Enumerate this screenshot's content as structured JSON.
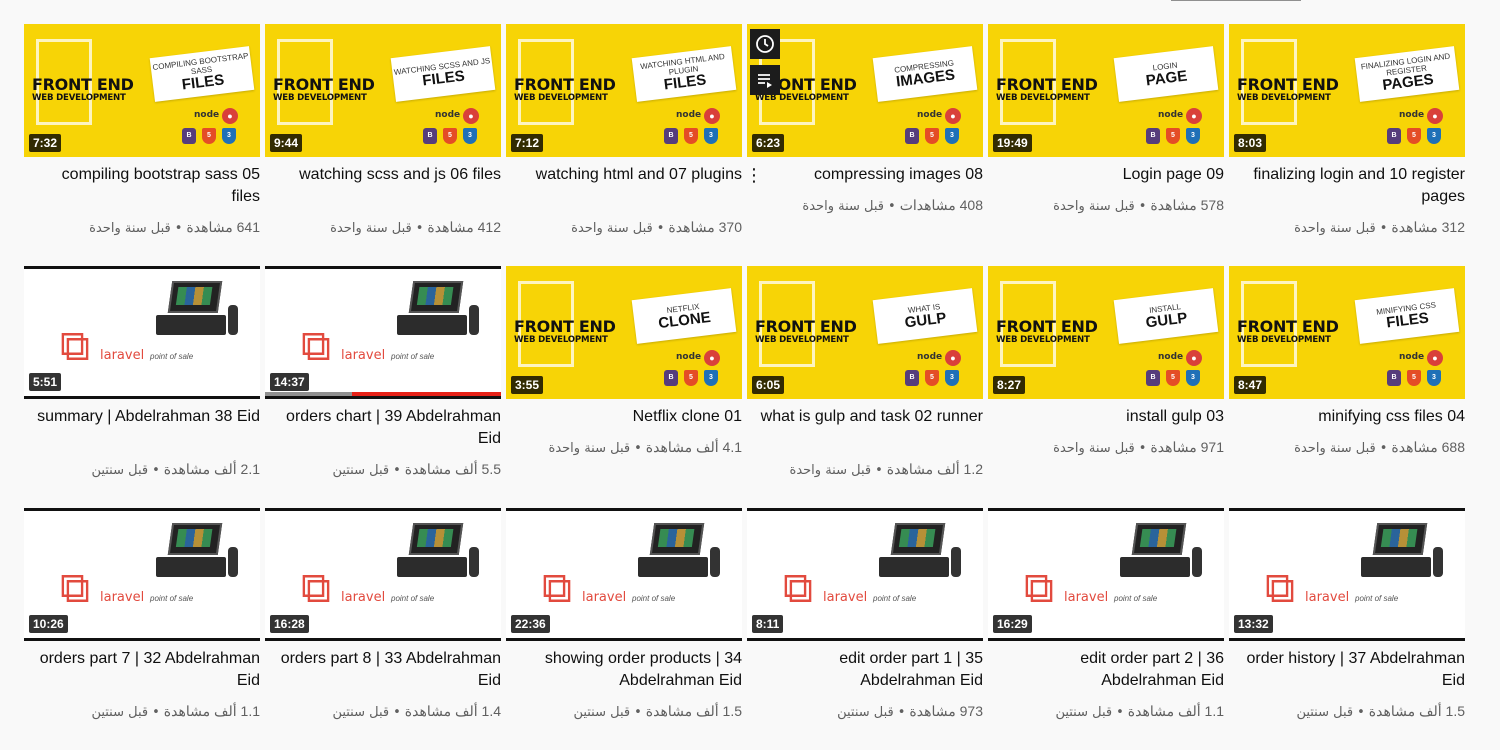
{
  "videos": [
    {
      "kind": "fe",
      "tag_small": "COMPILING BOOTSTRAP SASS",
      "tag_big": "FILES",
      "duration": "7:32",
      "title": "compiling bootstrap sass 05 files",
      "views": "641 مشاهدة",
      "age": "قبل سنة واحدة"
    },
    {
      "kind": "fe",
      "tag_small": "WATCHING SCSS AND JS",
      "tag_big": "FILES",
      "duration": "9:44",
      "title": "watching scss and js 06 files",
      "views": "412 مشاهدة",
      "age": "قبل سنة واحدة"
    },
    {
      "kind": "fe",
      "tag_small": "WATCHING HTML AND PLUGIN",
      "tag_big": "FILES",
      "duration": "7:12",
      "title": "watching html and 07 plugins",
      "views": "370 مشاهدة",
      "age": "قبل سنة واحدة"
    },
    {
      "kind": "fe",
      "tag_small": "COMPRESSING",
      "tag_big": "IMAGES",
      "duration": "6:23",
      "title": "compressing images 08",
      "views": "408 مشاهدات",
      "age": "قبل سنة واحدة",
      "hovered": true
    },
    {
      "kind": "fe",
      "tag_small": "LOGIN",
      "tag_big": "PAGE",
      "duration": "19:49",
      "title": "Login page 09",
      "views": "578 مشاهدة",
      "age": "قبل سنة واحدة"
    },
    {
      "kind": "fe",
      "tag_small": "FINALIZING LOGIN AND REGISTER",
      "tag_big": "PAGES",
      "duration": "8:03",
      "title": "finalizing login and 10 register pages",
      "views": "312 مشاهدة",
      "age": "قبل سنة واحدة"
    },
    {
      "kind": "laravel",
      "duration": "5:51",
      "title": "summary | Abdelrahman 38 Eid",
      "views": "2.1 ألف مشاهدة",
      "age": "قبل سنتين"
    },
    {
      "kind": "laravel",
      "duration": "14:37",
      "title": "orders chart | 39 Abdelrahman Eid",
      "views": "5.5 ألف مشاهدة",
      "age": "قبل سنتين",
      "progress": 0.63
    },
    {
      "kind": "fe",
      "tag_small": "NETFLIX",
      "tag_big": "CLONE",
      "duration": "3:55",
      "title": "Netflix clone 01",
      "views": "4.1 ألف مشاهدة",
      "age": "قبل سنة واحدة"
    },
    {
      "kind": "fe",
      "tag_small": "WHAT IS",
      "tag_big": "GULP",
      "duration": "6:05",
      "title": "what is gulp and task 02 runner",
      "views": "1.2 ألف مشاهدة",
      "age": "قبل سنة واحدة"
    },
    {
      "kind": "fe",
      "tag_small": "INSTALL",
      "tag_big": "GULP",
      "duration": "8:27",
      "title": "install gulp 03",
      "views": "971 مشاهدة",
      "age": "قبل سنة واحدة"
    },
    {
      "kind": "fe",
      "tag_small": "MINIFYING CSS",
      "tag_big": "FILES",
      "duration": "8:47",
      "title": "minifying css files 04",
      "views": "688 مشاهدة",
      "age": "قبل سنة واحدة"
    },
    {
      "kind": "laravel",
      "duration": "10:26",
      "title": "orders part 7 | 32 Abdelrahman Eid",
      "views": "1.1 ألف مشاهدة",
      "age": "قبل سنتين"
    },
    {
      "kind": "laravel",
      "duration": "16:28",
      "title": "orders part 8 | 33 Abdelrahman Eid",
      "views": "1.4 ألف مشاهدة",
      "age": "قبل سنتين"
    },
    {
      "kind": "laravel",
      "duration": "22:36",
      "title": "showing order products | 34 Abdelrahman Eid",
      "views": "1.5 ألف مشاهدة",
      "age": "قبل سنتين"
    },
    {
      "kind": "laravel",
      "duration": "8:11",
      "title": "edit order part 1 | 35 Abdelrahman Eid",
      "views": "973 مشاهدة",
      "age": "قبل سنتين"
    },
    {
      "kind": "laravel",
      "duration": "16:29",
      "title": "edit order part 2 | 36 Abdelrahman Eid",
      "views": "1.1 ألف مشاهدة",
      "age": "قبل سنتين"
    },
    {
      "kind": "laravel",
      "duration": "13:32",
      "title": "order history | 37 Abdelrahman Eid",
      "views": "1.5 ألف مشاهدة",
      "age": "قبل سنتين"
    }
  ],
  "thumb_text": {
    "fe_title": "FRONT END",
    "fe_subtitle": "WEB DEVELOPMENT",
    "node": "node",
    "laravel_word": "laravel",
    "laravel_tagline": "point of sale",
    "badge_html": "HTML",
    "badge_css": "CSS",
    "badge_bs": "B"
  },
  "separator": "•",
  "colors": {
    "thumb_yellow": "#f7d406",
    "progress_red": "#e62117",
    "laravel_red": "#e24a3e"
  },
  "icons": {
    "hover_top": "clock-icon",
    "hover_bottom": "queue-icon",
    "menu": "more-vert-icon"
  }
}
